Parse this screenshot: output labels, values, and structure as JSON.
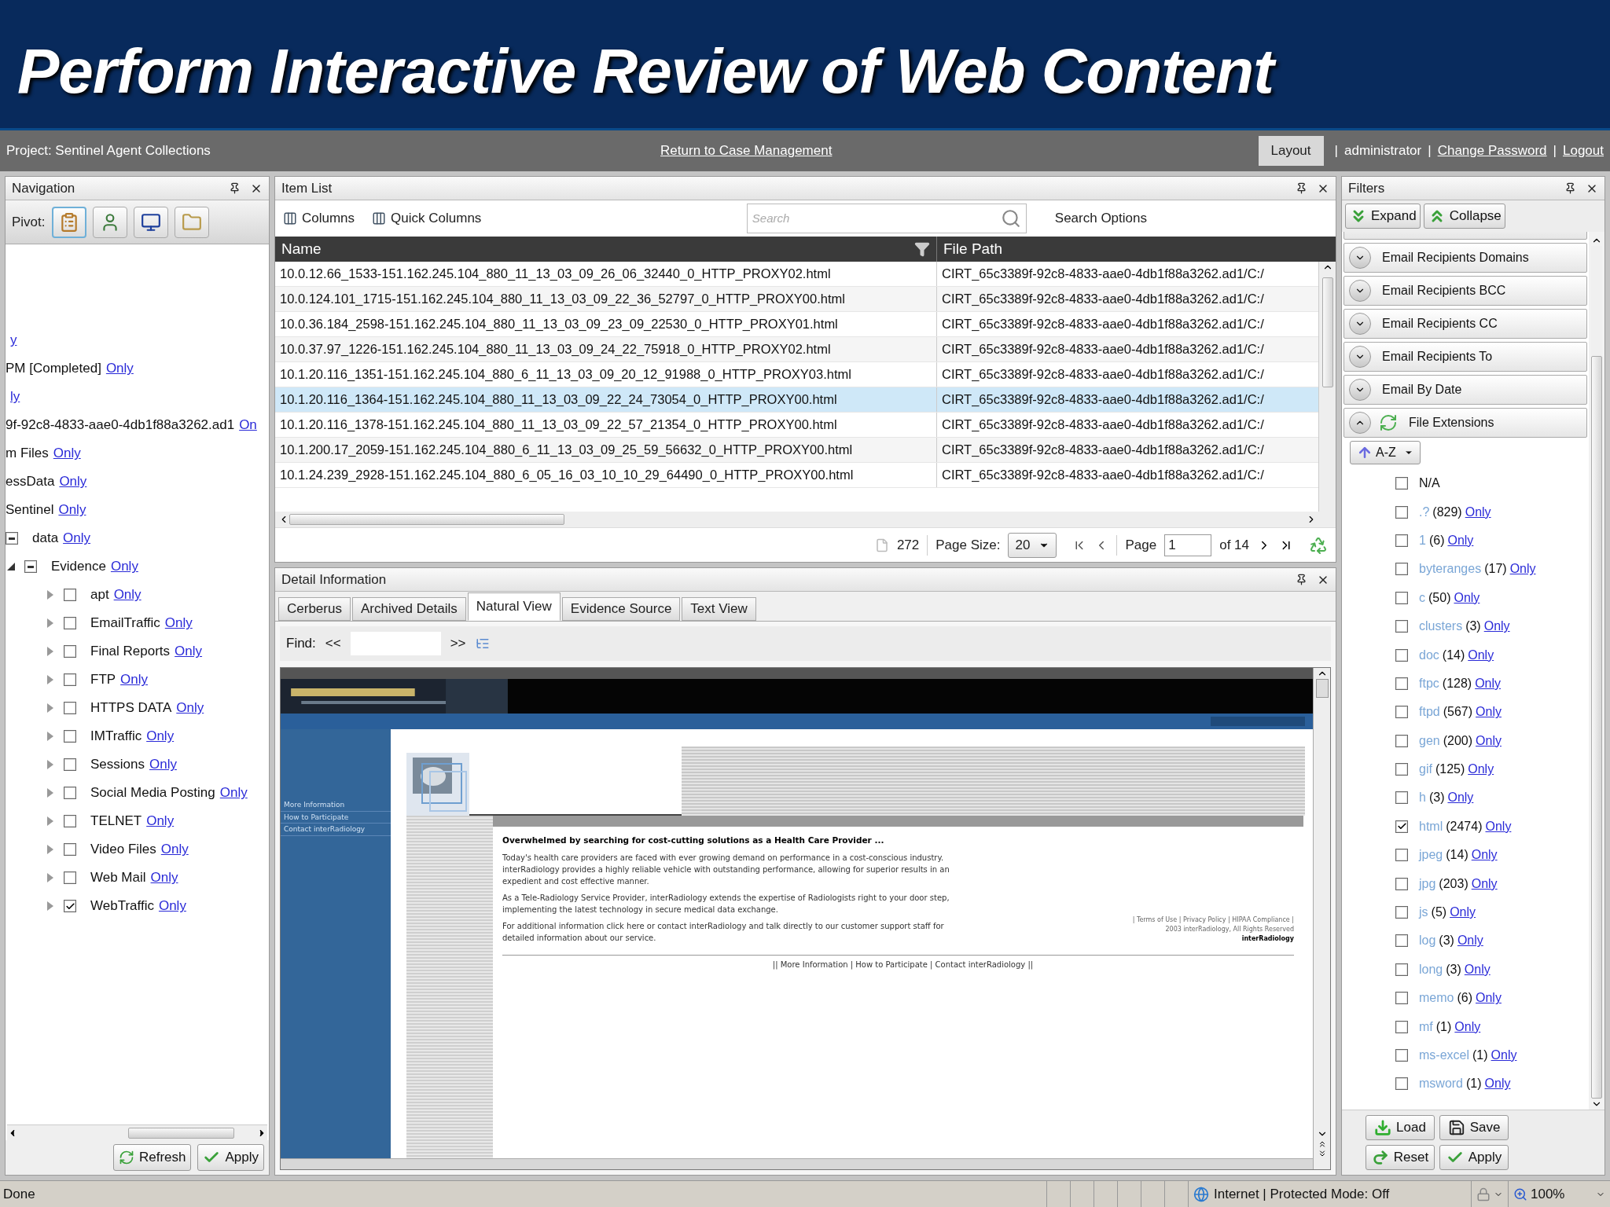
{
  "slide_title": "Perform Interactive Review of Web Content",
  "top_bar": {
    "project": "Project: Sentinel Agent Collections",
    "return_link": "Return to Case Management",
    "layout_button": "Layout",
    "separators": [
      "|",
      "|",
      "|"
    ],
    "user": "administrator",
    "links": [
      "Change Password",
      "Logout"
    ]
  },
  "navigation": {
    "title": "Navigation",
    "pivot_label": "Pivot:",
    "pivot_buttons": [
      {
        "kind": "clipboard",
        "selected": true
      },
      {
        "kind": "person",
        "selected": false
      },
      {
        "kind": "computer",
        "selected": false
      },
      {
        "kind": "folder",
        "selected": false
      }
    ],
    "tree": [
      {
        "link": "y"
      },
      {
        "text": "PM [Completed]",
        "link": "Only"
      },
      {
        "link": "ly"
      },
      {
        "text": "9f-92c8-4833-aae0-4db1f88a3262.ad1",
        "link": "On"
      },
      {
        "text": "m Files",
        "link": "Only"
      },
      {
        "text": "essData",
        "link": "Only"
      },
      {
        "text": "Sentinel",
        "link": "Only"
      },
      {
        "text": "data",
        "link": "Only",
        "partial": true
      },
      {
        "text": "Evidence",
        "link": "Only",
        "partial": true,
        "expanded": true,
        "children": [
          {
            "text": "apt",
            "link": "Only",
            "checked": false,
            "expanded": false
          },
          {
            "text": "EmailTraffic",
            "link": "Only",
            "checked": false,
            "expanded": false
          },
          {
            "text": "Final Reports",
            "link": "Only",
            "checked": false,
            "expanded": false
          },
          {
            "text": "FTP",
            "link": "Only",
            "checked": false,
            "expanded": false
          },
          {
            "text": "HTTPS DATA",
            "link": "Only",
            "checked": false,
            "expanded": false
          },
          {
            "text": "IMTraffic",
            "link": "Only",
            "checked": false,
            "expanded": false
          },
          {
            "text": "Sessions",
            "link": "Only",
            "checked": false,
            "expanded": false
          },
          {
            "text": "Social Media Posting",
            "link": "Only",
            "checked": false,
            "expanded": false
          },
          {
            "text": "TELNET",
            "link": "Only",
            "checked": false,
            "expanded": false
          },
          {
            "text": "Video Files",
            "link": "Only",
            "checked": false,
            "expanded": false
          },
          {
            "text": "Web Mail",
            "link": "Only",
            "checked": false,
            "expanded": false
          },
          {
            "text": "WebTraffic",
            "link": "Only",
            "checked": true,
            "expanded": false
          }
        ]
      }
    ],
    "buttons": [
      "Refresh",
      "Apply"
    ]
  },
  "item_list": {
    "title": "Item List",
    "toolbar": [
      "Columns",
      "Quick Columns"
    ],
    "search": {
      "placeholder": "Search"
    },
    "search_options": "Search Options",
    "columns": [
      "Name",
      "File Path"
    ],
    "rows": [
      {
        "name": "10.0.12.66_1533-151.162.245.104_880_11_13_03_09_26_06_32440_0_HTTP_PROXY02.html",
        "path": "CIRT_65c3389f-92c8-4833-aae0-4db1f88a3262.ad1/C:/",
        "selected": false
      },
      {
        "name": "10.0.124.101_1715-151.162.245.104_880_11_13_03_09_22_36_52797_0_HTTP_PROXY00.html",
        "path": "CIRT_65c3389f-92c8-4833-aae0-4db1f88a3262.ad1/C:/",
        "selected": false
      },
      {
        "name": "10.0.36.184_2598-151.162.245.104_880_11_13_03_09_23_09_22530_0_HTTP_PROXY01.html",
        "path": "CIRT_65c3389f-92c8-4833-aae0-4db1f88a3262.ad1/C:/",
        "selected": false
      },
      {
        "name": "10.0.37.97_1226-151.162.245.104_880_11_13_03_09_24_22_75918_0_HTTP_PROXY02.html",
        "path": "CIRT_65c3389f-92c8-4833-aae0-4db1f88a3262.ad1/C:/",
        "selected": false
      },
      {
        "name": "10.1.20.116_1351-151.162.245.104_880_6_11_13_03_09_20_12_91988_0_HTTP_PROXY03.html",
        "path": "CIRT_65c3389f-92c8-4833-aae0-4db1f88a3262.ad1/C:/",
        "selected": false
      },
      {
        "name": "10.1.20.116_1364-151.162.245.104_880_11_13_03_09_22_24_73054_0_HTTP_PROXY00.html",
        "path": "CIRT_65c3389f-92c8-4833-aae0-4db1f88a3262.ad1/C:/",
        "selected": true
      },
      {
        "name": "10.1.20.116_1378-151.162.245.104_880_11_13_03_09_22_57_21354_0_HTTP_PROXY00.html",
        "path": "CIRT_65c3389f-92c8-4833-aae0-4db1f88a3262.ad1/C:/",
        "selected": false
      },
      {
        "name": "10.1.200.17_2059-151.162.245.104_880_6_11_13_03_09_25_59_56632_0_HTTP_PROXY00.html",
        "path": "CIRT_65c3389f-92c8-4833-aae0-4db1f88a3262.ad1/C:/",
        "selected": false
      },
      {
        "name": "10.1.24.239_2928-151.162.245.104_880_6_05_16_03_10_10_29_64490_0_HTTP_PROXY00.html",
        "path": "CIRT_65c3389f-92c8-4833-aae0-4db1f88a3262.ad1/C:/",
        "selected": false
      }
    ],
    "pager": {
      "total": "272",
      "page_size_label": "Page Size:",
      "page_size": "20",
      "page_label": "Page",
      "page": "1",
      "of": "of 14"
    }
  },
  "detail": {
    "title": "Detail Information",
    "tabs": [
      {
        "label": "Cerberus",
        "selected": false
      },
      {
        "label": "Archived Details",
        "selected": false
      },
      {
        "label": "Natural View",
        "selected": true
      },
      {
        "label": "Evidence Source",
        "selected": false
      },
      {
        "label": "Text View",
        "selected": false
      }
    ],
    "find": {
      "label": "Find:",
      "prev": "<<",
      "next": ">>"
    },
    "page": {
      "nav_links": [
        "More Information",
        "How to Participate",
        "Contact interRadiology"
      ],
      "heading": "Overwhelmed by searching for cost-cutting solutions as a Health Care Provider ...",
      "paragraphs": [
        "Today's health care providers are faced with ever growing demand on performance in a cost-conscious industry. interRadiology provides a highly reliable vehicle with outstanding performance, allowing for superior results in an expedient and cost effective manner.",
        "As a Tele-Radiology Service Provider, interRadiology extends the expertise of Radiologists right to your door step, implementing the latest technology in secure medical data exchange.",
        "For additional information click here or contact interRadiology and talk directly to our customer support staff for detailed information about our service."
      ],
      "side_lines": [
        "| Terms of Use | Privacy Policy | HIPAA Compliance |",
        "2003 interRadiology, All Rights Reserved",
        "interRadiology"
      ],
      "footer": "|| More Information | How to Participate | Contact interRadiology ||"
    }
  },
  "filters": {
    "title": "Filters",
    "top_buttons": [
      "Expand",
      "Collapse"
    ],
    "sections": [
      {
        "label": "Email Recipients Domains",
        "expanded": false
      },
      {
        "label": "Email Recipients BCC",
        "expanded": false
      },
      {
        "label": "Email Recipients CC",
        "expanded": false
      },
      {
        "label": "Email Recipients To",
        "expanded": false
      },
      {
        "label": "Email By Date",
        "expanded": false
      },
      {
        "label": "File Extensions",
        "expanded": true
      }
    ],
    "sort_button": "A-Z",
    "extensions": [
      {
        "name": "N/A",
        "checked": false
      },
      {
        "name": ".?",
        "count": "(829)",
        "link": "Only",
        "checked": false
      },
      {
        "name": "1",
        "count": "(6)",
        "link": "Only",
        "checked": false
      },
      {
        "name": "byteranges",
        "count": "(17)",
        "link": "Only",
        "checked": false
      },
      {
        "name": "c",
        "count": "(50)",
        "link": "Only",
        "checked": false
      },
      {
        "name": "clusters",
        "count": "(3)",
        "link": "Only",
        "checked": false
      },
      {
        "name": "doc",
        "count": "(14)",
        "link": "Only",
        "checked": false
      },
      {
        "name": "ftpc",
        "count": "(128)",
        "link": "Only",
        "checked": false
      },
      {
        "name": "ftpd",
        "count": "(567)",
        "link": "Only",
        "checked": false
      },
      {
        "name": "gen",
        "count": "(200)",
        "link": "Only",
        "checked": false
      },
      {
        "name": "gif",
        "count": "(125)",
        "link": "Only",
        "checked": false
      },
      {
        "name": "h",
        "count": "(3)",
        "link": "Only",
        "checked": false
      },
      {
        "name": "html",
        "count": "(2474)",
        "link": "Only",
        "checked": true
      },
      {
        "name": "jpeg",
        "count": "(14)",
        "link": "Only",
        "checked": false
      },
      {
        "name": "jpg",
        "count": "(203)",
        "link": "Only",
        "checked": false
      },
      {
        "name": "js",
        "count": "(5)",
        "link": "Only",
        "checked": false
      },
      {
        "name": "log",
        "count": "(3)",
        "link": "Only",
        "checked": false
      },
      {
        "name": "long",
        "count": "(3)",
        "link": "Only",
        "checked": false
      },
      {
        "name": "memo",
        "count": "(6)",
        "link": "Only",
        "checked": false
      },
      {
        "name": "mf",
        "count": "(1)",
        "link": "Only",
        "checked": false
      },
      {
        "name": "ms-excel",
        "count": "(1)",
        "link": "Only",
        "checked": false
      },
      {
        "name": "msword",
        "count": "(1)",
        "link": "Only",
        "checked": false
      }
    ],
    "bottom_buttons": [
      {
        "kind": "load",
        "label": "Load"
      },
      {
        "kind": "save",
        "label": "Save"
      },
      {
        "kind": "reset",
        "label": "Reset"
      },
      {
        "kind": "apply",
        "label": "Apply"
      }
    ]
  },
  "status_bar": {
    "text": "Done",
    "zone": "Internet | Protected Mode: Off",
    "zoom": "100%"
  }
}
